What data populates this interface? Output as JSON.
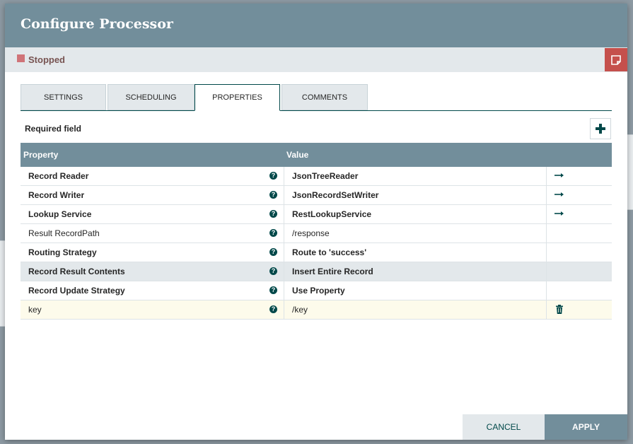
{
  "dialog": {
    "title": "Configure Processor"
  },
  "status": {
    "text": "Stopped"
  },
  "tabs": [
    {
      "label": "SETTINGS"
    },
    {
      "label": "SCHEDULING"
    },
    {
      "label": "PROPERTIES"
    },
    {
      "label": "COMMENTS"
    }
  ],
  "properties": {
    "required_label": "Required field",
    "headers": {
      "property": "Property",
      "value": "Value"
    },
    "rows": [
      {
        "name": "Record Reader",
        "value": "JsonTreeReader"
      },
      {
        "name": "Record Writer",
        "value": "JsonRecordSetWriter"
      },
      {
        "name": "Lookup Service",
        "value": "RestLookupService"
      },
      {
        "name": "Result RecordPath",
        "value": "/response"
      },
      {
        "name": "Routing Strategy",
        "value": "Route to 'success'"
      },
      {
        "name": "Record Result Contents",
        "value": "Insert Entire Record"
      },
      {
        "name": "Record Update Strategy",
        "value": "Use Property"
      },
      {
        "name": "key",
        "value": "/key"
      }
    ]
  },
  "footer": {
    "cancel": "CANCEL",
    "apply": "APPLY"
  },
  "colors": {
    "header": "#728e9b",
    "accent": "#004849",
    "stopped": "#d07479",
    "notes": "#c5504c"
  },
  "icons": {
    "help": "question-circle-icon",
    "goto": "arrow-right-icon",
    "delete": "trash-icon",
    "add": "plus-icon",
    "notes": "sticky-note-icon"
  }
}
